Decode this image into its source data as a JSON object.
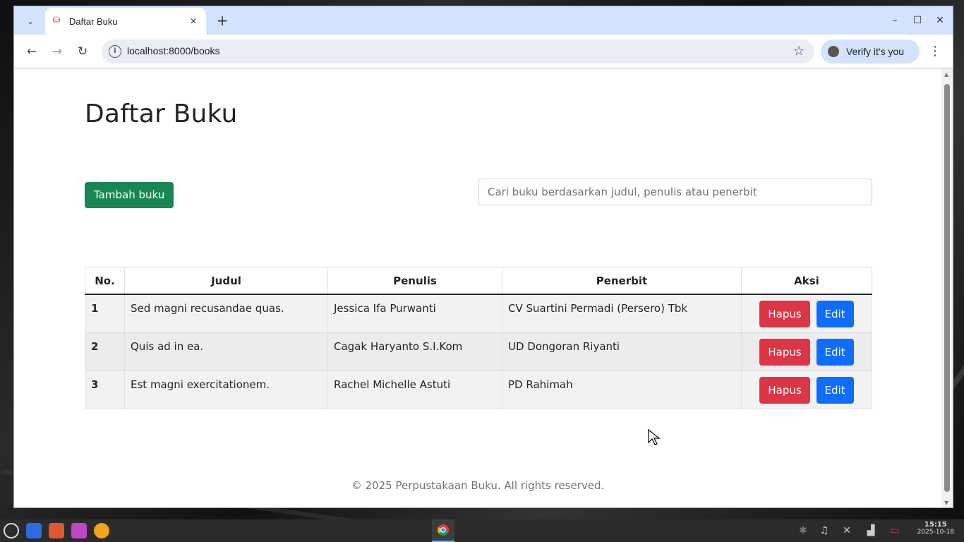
{
  "browser": {
    "tab_title": "Daftar Buku",
    "url": "localhost:8000/books",
    "verify_label": "Verify it's you"
  },
  "page": {
    "title": "Daftar Buku",
    "add_button": "Tambah buku",
    "search_placeholder": "Cari buku berdasarkan judul, penulis atau penerbit"
  },
  "table": {
    "headers": [
      "No.",
      "Judul",
      "Penulis",
      "Penerbit",
      "Aksi"
    ],
    "rows": [
      {
        "no": "1",
        "judul": "Sed magni recusandae quas.",
        "penulis": "Jessica Ifa Purwanti",
        "penerbit": "CV Suartini Permadi (Persero) Tbk"
      },
      {
        "no": "2",
        "judul": "Quis ad in ea.",
        "penulis": "Cagak Haryanto S.I.Kom",
        "penerbit": "UD Dongoran Riyanti"
      },
      {
        "no": "3",
        "judul": "Est magni exercitationem.",
        "penulis": "Rachel Michelle Astuti",
        "penerbit": "PD Rahimah"
      }
    ],
    "delete_label": "Hapus",
    "edit_label": "Edit"
  },
  "footer": {
    "text": "© 2025 Perpustakaan Buku. All rights reserved."
  },
  "taskbar": {
    "time": "15:15",
    "date": "2025-10-18"
  },
  "colors": {
    "success": "#198754",
    "danger": "#dc3545",
    "primary": "#0d6efd",
    "tabbar": "#d3e3fd"
  }
}
